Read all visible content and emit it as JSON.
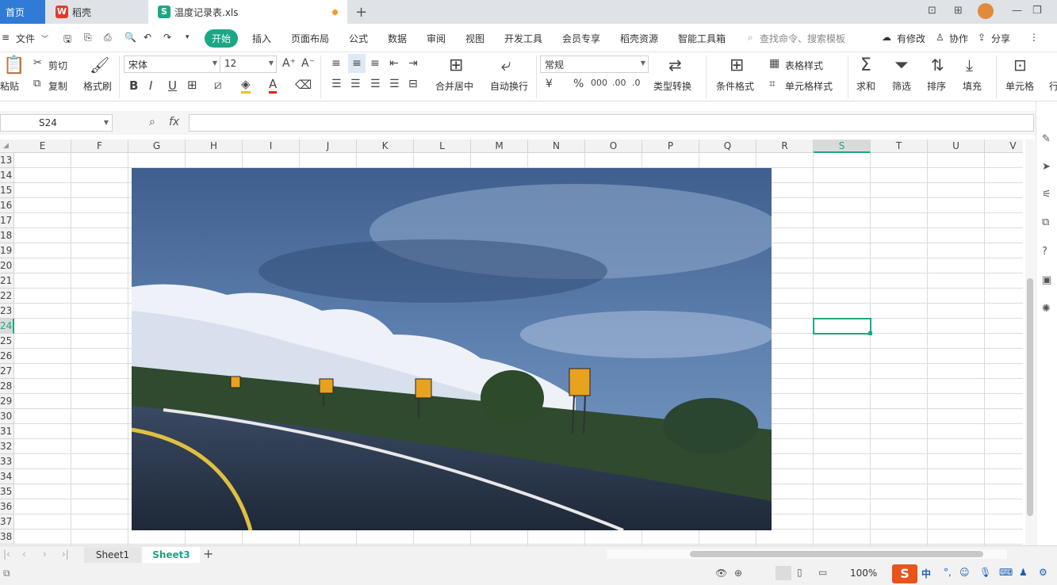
{
  "titlebar": {
    "tab_home": "首页",
    "tab_daoke": "稻壳",
    "tab_file": "温度记录表.xls",
    "plus": "+"
  },
  "menubar": {
    "file": "文件",
    "items": [
      "开始",
      "插入",
      "页面布局",
      "公式",
      "数据",
      "审阅",
      "视图",
      "开发工具",
      "会员专享",
      "稻壳资源",
      "智能工具箱"
    ],
    "search_placeholder": "查找命令、搜索模板",
    "modified": "有修改",
    "collab": "协作",
    "share": "分享"
  },
  "ribbon": {
    "paste": "粘贴",
    "cut": "剪切",
    "copy": "复制",
    "format_painter": "格式刷",
    "font_name": "宋体",
    "font_size": "12",
    "merge_center": "合并居中",
    "auto_wrap": "自动换行",
    "number_format": "常规",
    "type_convert": "类型转换",
    "cond_format": "条件格式",
    "table_style": "表格样式",
    "cell_style": "单元格样式",
    "sum": "求和",
    "filter": "筛选",
    "sort": "排序",
    "fill": "填充",
    "cell": "单元格",
    "row_partial": "行"
  },
  "formula_bar": {
    "name_box": "S24",
    "fx": "fx",
    "formula": ""
  },
  "grid": {
    "columns": [
      "E",
      "F",
      "G",
      "H",
      "I",
      "J",
      "K",
      "L",
      "M",
      "N",
      "O",
      "P",
      "Q",
      "R",
      "S",
      "T",
      "U",
      "V"
    ],
    "active_column": "S",
    "rows": [
      "13",
      "14",
      "15",
      "16",
      "17",
      "18",
      "19",
      "20",
      "21",
      "22",
      "23",
      "24",
      "25",
      "26",
      "27",
      "28",
      "29",
      "30",
      "31",
      "32",
      "33",
      "34",
      "35",
      "36",
      "37",
      "38"
    ],
    "active_row": "24"
  },
  "sheets": {
    "tabs": [
      "Sheet1",
      "Sheet3"
    ],
    "active": "Sheet3",
    "add": "+"
  },
  "statusbar": {
    "zoom": "100%",
    "ime": "中"
  },
  "colors": {
    "accent": "#1ba784",
    "home_tab": "#2f7bd6"
  }
}
